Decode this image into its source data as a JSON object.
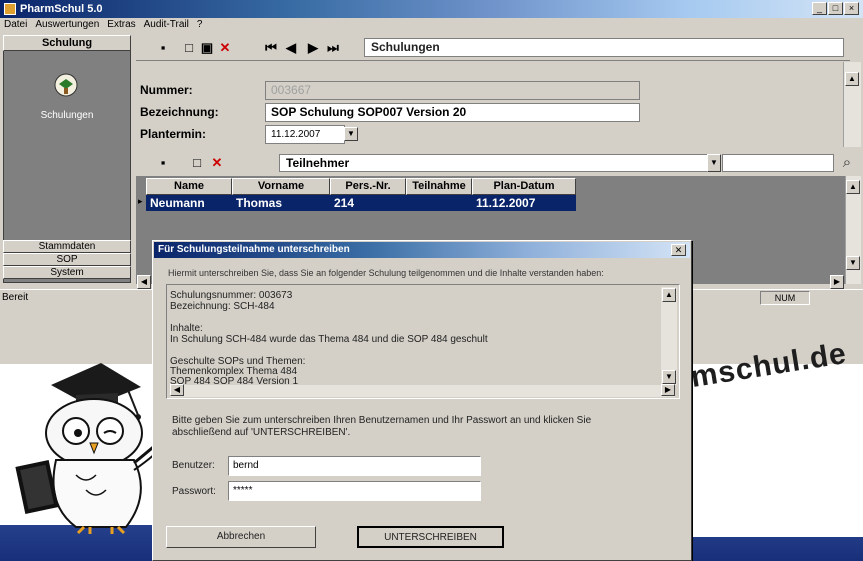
{
  "window": {
    "title": "PharmSchul 5.0",
    "buttons": [
      "_",
      "□",
      "×"
    ]
  },
  "menubar": {
    "items": [
      "Datei",
      "Auswertungen",
      "Extras",
      "Audit-Trail",
      "?"
    ]
  },
  "leftnav": {
    "header": "Schulung",
    "module_label": "Schulungen",
    "bottom_buttons": [
      "Stammdaten",
      "SOP",
      "System"
    ]
  },
  "toolbar": {
    "title": "Schulungen",
    "icons": [
      "new-record-icon",
      "new-document-icon",
      "save-icon",
      "delete-icon",
      "first-record-icon",
      "previous-record-icon",
      "next-record-icon",
      "last-record-icon"
    ]
  },
  "form": {
    "nummer_label": "Nummer:",
    "nummer_value": "003667",
    "bezeichnung_label": "Bezeichnung:",
    "bezeichnung_value": "SOP Schulung SOP007 Version 20",
    "plantermin_label": "Plantermin:",
    "plantermin_value": "11.12.2007"
  },
  "participants": {
    "title": "Teilnehmer",
    "columns": [
      "Name",
      "Vorname",
      "Pers.-Nr.",
      "Teilnahme",
      "Plan-Datum"
    ],
    "rows": [
      {
        "name": "Neumann",
        "vorname": "Thomas",
        "persnr": "214",
        "teilnahme": "",
        "plandatum": "11.12.2007"
      }
    ]
  },
  "statusbar": {
    "text": "Bereit",
    "num": "NUM"
  },
  "dialog": {
    "title": "Für Schulungsteilnahme unterschreiben",
    "intro": "Hiermit unterschreiben Sie, dass Sie an folgender Schulung teilgenommen und die Inhalte verstanden haben:",
    "info_lines": [
      "Schulungsnummer: 003673",
      "Bezeichnung: SCH-484",
      "",
      "Inhalte:",
      "In Schulung SCH-484 wurde das Thema 484 und die SOP 484 geschult",
      "",
      "Geschulte SOPs und Themen:",
      "Themenkomplex Thema 484",
      "SOP 484 SOP 484 Version 1"
    ],
    "instruction": "Bitte geben Sie zum unterschreiben Ihren Benutzernamen und Ihr Passwort an und klicken Sie abschließend auf 'UNTERSCHREIBEN'.",
    "benutzer_label": "Benutzer:",
    "benutzer_value": "bernd",
    "passwort_label": "Passwort:",
    "passwort_value": "*****",
    "cancel_label": "Abbrechen",
    "sign_label": "UNTERSCHREIBEN"
  },
  "watermark": "www.pharmschul.de",
  "colors": {
    "titlebar_start": "#0a246a",
    "selection": "#0a246a",
    "delete_red": "#cc0000",
    "bottom_band": "#1e3a8a"
  }
}
